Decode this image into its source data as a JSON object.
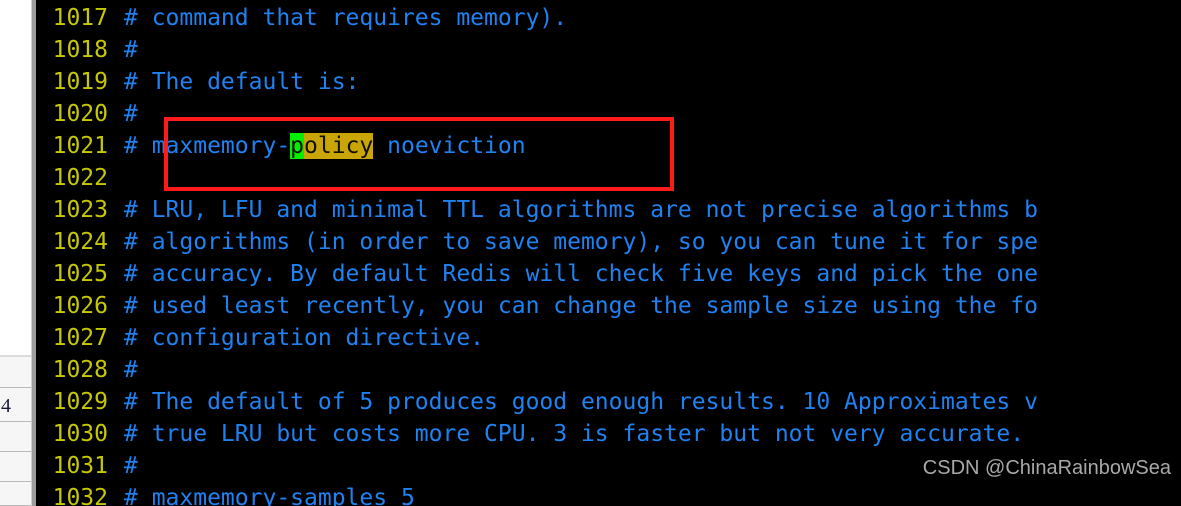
{
  "window": {
    "background_color": "#000000",
    "left_panel_color": "#ffffff",
    "left_panel_lower_color": "#f6f6f6",
    "left_panel_cell_value": "4"
  },
  "colors": {
    "line_number": "#c8c800",
    "comment_text": "#1e82f0",
    "cursor_highlight": "#00ee00",
    "search_match_highlight": "#c9a606",
    "annotation_box": "#ff1b1b",
    "watermark": "#a8a8a8"
  },
  "editor": {
    "file_type": "redis-conf",
    "lines": [
      {
        "number": "1017",
        "text": "# command that requires memory)."
      },
      {
        "number": "1018",
        "text": "#"
      },
      {
        "number": "1019",
        "text": "# The default is:"
      },
      {
        "number": "1020",
        "text": "#"
      },
      {
        "number": "1021",
        "prefix": "# maxmemory-",
        "cursor_char": "p",
        "match_rest": "olicy",
        "suffix": " noeviction"
      },
      {
        "number": "1022",
        "text": ""
      },
      {
        "number": "1023",
        "text": "# LRU, LFU and minimal TTL algorithms are not precise algorithms b"
      },
      {
        "number": "1024",
        "text": "# algorithms (in order to save memory), so you can tune it for spe"
      },
      {
        "number": "1025",
        "text": "# accuracy. By default Redis will check five keys and pick the one"
      },
      {
        "number": "1026",
        "text": "# used least recently, you can change the sample size using the fo"
      },
      {
        "number": "1027",
        "text": "# configuration directive."
      },
      {
        "number": "1028",
        "text": "#"
      },
      {
        "number": "1029",
        "text": "# The default of 5 produces good enough results. 10 Approximates v"
      },
      {
        "number": "1030",
        "text": "# true LRU but costs more CPU. 3 is faster but not very accurate."
      },
      {
        "number": "1031",
        "text": "#"
      },
      {
        "number": "1032",
        "text": "# maxmemory-samples 5"
      }
    ]
  },
  "annotation": {
    "shape": "rectangle",
    "covers_lines": "1021-1022"
  },
  "watermark": {
    "text": "CSDN @ChinaRainbowSea"
  }
}
